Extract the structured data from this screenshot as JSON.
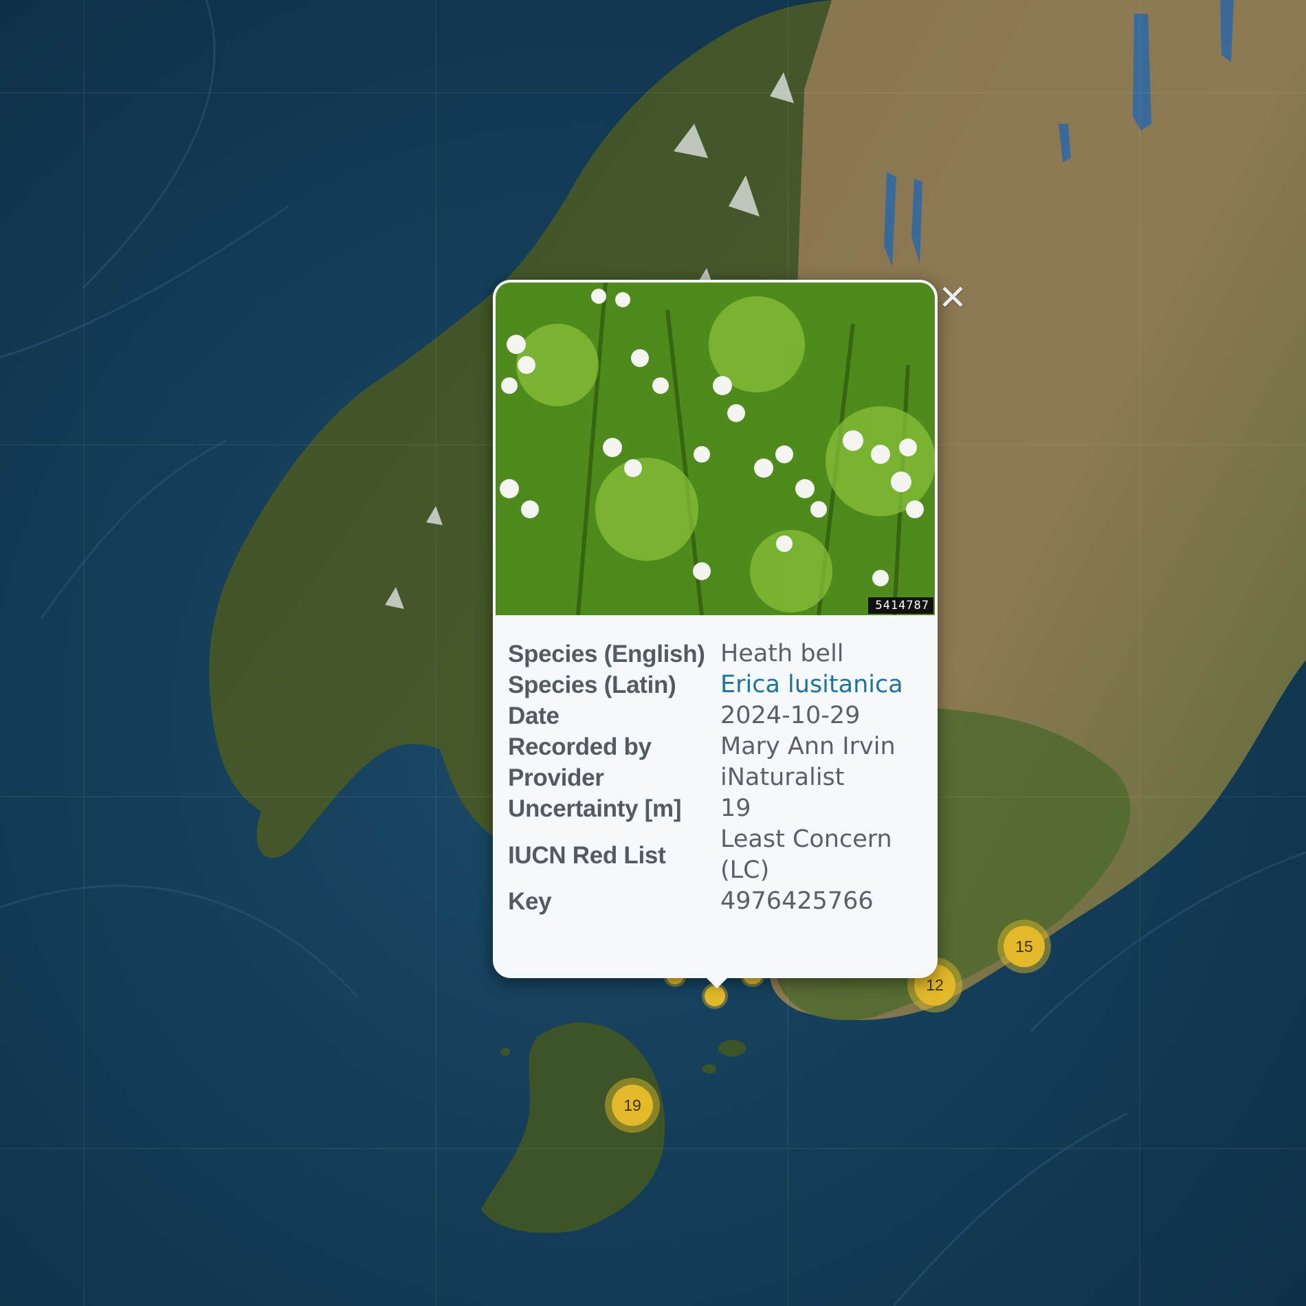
{
  "map": {
    "clusters": [
      {
        "id": "cluster-15",
        "count": "15"
      },
      {
        "id": "cluster-12",
        "count": "12"
      },
      {
        "id": "cluster-19",
        "count": "19"
      }
    ],
    "colors": {
      "ocean": "#123a56",
      "cluster": "#e3b92a",
      "link": "#1d739c"
    }
  },
  "popup": {
    "close_icon": "close-icon",
    "photo": {
      "id_label": "5414787"
    },
    "attributes": [
      {
        "label": "Species (English)",
        "value": "Heath bell"
      },
      {
        "label": "Species (Latin)",
        "value": "Erica lusitanica"
      },
      {
        "label": "Date",
        "value": "2024-10-29"
      },
      {
        "label": "Recorded by",
        "value": "Mary Ann Irvin"
      },
      {
        "label": "Provider",
        "value": "iNaturalist"
      },
      {
        "label": "Uncertainty [m]",
        "value": "19"
      },
      {
        "label": "IUCN Red List",
        "value": "Least Concern (LC)"
      },
      {
        "label": "Key",
        "value": "4976425766"
      }
    ]
  }
}
